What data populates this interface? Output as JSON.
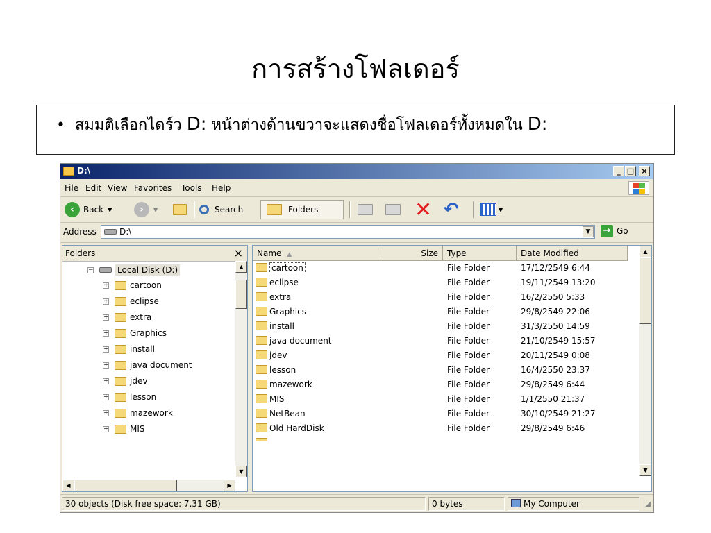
{
  "slide": {
    "title": "การสร้างโฟลเดอร์",
    "bullet_marker": "•",
    "bullet_part1": "สมมติเลือกไดร์ว ",
    "bullet_drive1": "D:",
    "bullet_part2": " หน้าต่างด้านขวาจะแสดงชื่อโฟลเดอร์ทั้งหมดใน ",
    "bullet_drive2": "D:"
  },
  "window": {
    "title": "D:\\",
    "caption_buttons": {
      "minimize": "_",
      "maximize": "□",
      "close": "×"
    },
    "menu": [
      "File",
      "Edit",
      "View",
      "Favorites",
      "Tools",
      "Help"
    ],
    "toolbar": {
      "back_label": "Back",
      "search_label": "Search",
      "folders_label": "Folders"
    },
    "address": {
      "label": "Address",
      "value": "D:\\",
      "go_label": "Go"
    },
    "folders_pane": {
      "title": "Folders",
      "close": "×",
      "root": "Local Disk (D:)",
      "items": [
        "cartoon",
        "eclipse",
        "extra",
        "Graphics",
        "install",
        "java document",
        "jdev",
        "lesson",
        "mazework",
        "MIS"
      ]
    },
    "list": {
      "columns": [
        "Name",
        "Size",
        "Type",
        "Date Modified"
      ],
      "rows": [
        {
          "name": "cartoon",
          "type": "File Folder",
          "date": "17/12/2549 6:44"
        },
        {
          "name": "eclipse",
          "type": "File Folder",
          "date": "19/11/2549 13:20"
        },
        {
          "name": "extra",
          "type": "File Folder",
          "date": "16/2/2550 5:33"
        },
        {
          "name": "Graphics",
          "type": "File Folder",
          "date": "29/8/2549 22:06"
        },
        {
          "name": "install",
          "type": "File Folder",
          "date": "31/3/2550 14:59"
        },
        {
          "name": "java document",
          "type": "File Folder",
          "date": "21/10/2549 15:57"
        },
        {
          "name": "jdev",
          "type": "File Folder",
          "date": "20/11/2549 0:08"
        },
        {
          "name": "lesson",
          "type": "File Folder",
          "date": "16/4/2550 23:37"
        },
        {
          "name": "mazework",
          "type": "File Folder",
          "date": "29/8/2549 6:44"
        },
        {
          "name": "MIS",
          "type": "File Folder",
          "date": "1/1/2550 21:37"
        },
        {
          "name": "NetBean",
          "type": "File Folder",
          "date": "30/10/2549 21:27"
        },
        {
          "name": "Old HardDisk",
          "type": "File Folder",
          "date": "29/8/2549 6:46"
        }
      ]
    },
    "status": {
      "objects": "30 objects (Disk free space: 7.31 GB)",
      "size": "0 bytes",
      "zone": "My Computer"
    }
  },
  "colors": {
    "titlebar_start": "#0a246a",
    "titlebar_end": "#a6caf0",
    "window_bg": "#ece9d8",
    "folder_yellow": "#f5d878",
    "delete_red": "#e02020"
  },
  "icons": [
    "folder-icon",
    "drive-icon",
    "back-arrow-icon",
    "forward-arrow-icon",
    "up-folder-icon",
    "search-icon",
    "move-to-icon",
    "copy-to-icon",
    "delete-icon",
    "undo-icon",
    "views-icon",
    "go-arrow-icon",
    "my-computer-icon",
    "windows-logo-icon"
  ]
}
